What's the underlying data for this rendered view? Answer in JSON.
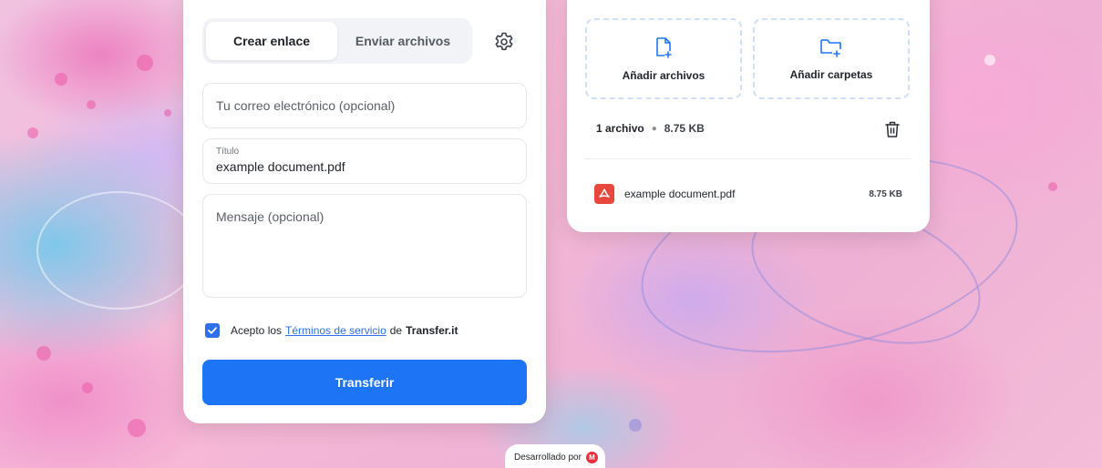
{
  "tabs": [
    {
      "label": "Crear enlace",
      "active": true
    },
    {
      "label": "Enviar archivos",
      "active": false
    }
  ],
  "form": {
    "email_placeholder": "Tu correo electrónico (opcional)",
    "title_label": "Título",
    "title_value": "example document.pdf",
    "message_placeholder": "Mensaje (opcional)",
    "terms": {
      "checked": true,
      "prefix": "Acepto los",
      "link": "Términos de servicio",
      "middle": "de",
      "brand": "Transfer.it"
    },
    "submit_label": "Transferir"
  },
  "upload": {
    "add_files_label": "Añadir archivos",
    "add_folders_label": "Añadir carpetas",
    "count_label": "1 archivo",
    "total_size": "8.75 KB",
    "files": [
      {
        "name": "example document.pdf",
        "size": "8.75 KB",
        "icon": "pdf-icon"
      }
    ]
  },
  "footer": {
    "powered_by": "Desarrollado por"
  },
  "colors": {
    "accent": "#1d74f5",
    "link": "#2f6fea",
    "pdf": "#e8473e",
    "mega": "#e8303c"
  }
}
